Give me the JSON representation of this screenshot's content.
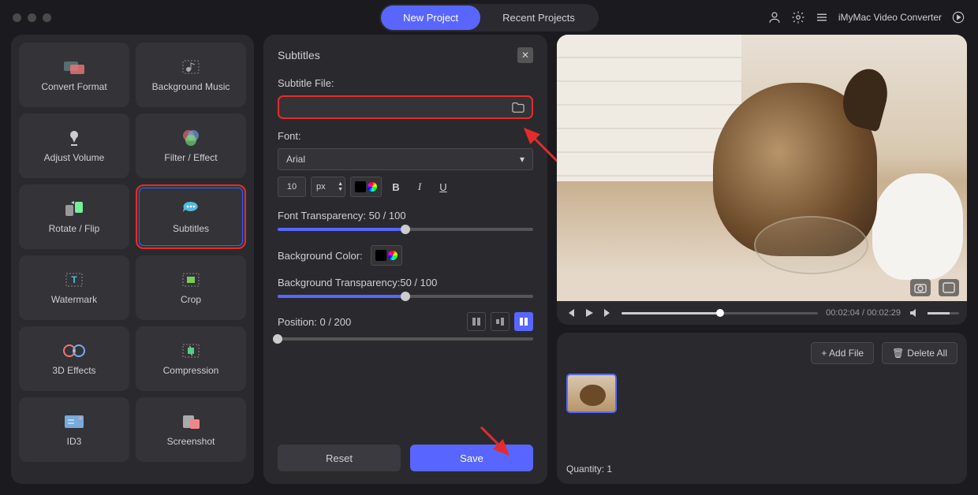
{
  "app_name": "iMyMac Video Converter",
  "tabs": {
    "new": "New Project",
    "recent": "Recent Projects"
  },
  "sidebar": {
    "items": [
      {
        "label": "Convert Format"
      },
      {
        "label": "Background Music"
      },
      {
        "label": "Adjust Volume"
      },
      {
        "label": "Filter / Effect"
      },
      {
        "label": "Rotate / Flip"
      },
      {
        "label": "Subtitles"
      },
      {
        "label": "Watermark"
      },
      {
        "label": "Crop"
      },
      {
        "label": "3D Effects"
      },
      {
        "label": "Compression"
      },
      {
        "label": "ID3"
      },
      {
        "label": "Screenshot"
      }
    ]
  },
  "panel": {
    "title": "Subtitles",
    "file_label": "Subtitle File:",
    "file_value": "",
    "font_label": "Font:",
    "font_name": "Arial",
    "font_size": "10",
    "font_unit": "px",
    "font_transparency_label": "Font Transparency: 50 / 100",
    "font_transparency": 50,
    "bg_color_label": "Background Color:",
    "bg_transparency_label": "Background Transparency:50 / 100",
    "bg_transparency": 50,
    "position_label": "Position: 0 / 200",
    "position": 0,
    "reset": "Reset",
    "save": "Save"
  },
  "player": {
    "current": "00:02:04",
    "total": "00:02:29",
    "sep": " / "
  },
  "filelist": {
    "add": "+ Add File",
    "delete": "Delete All",
    "quantity_label": "Quantity: 1"
  }
}
